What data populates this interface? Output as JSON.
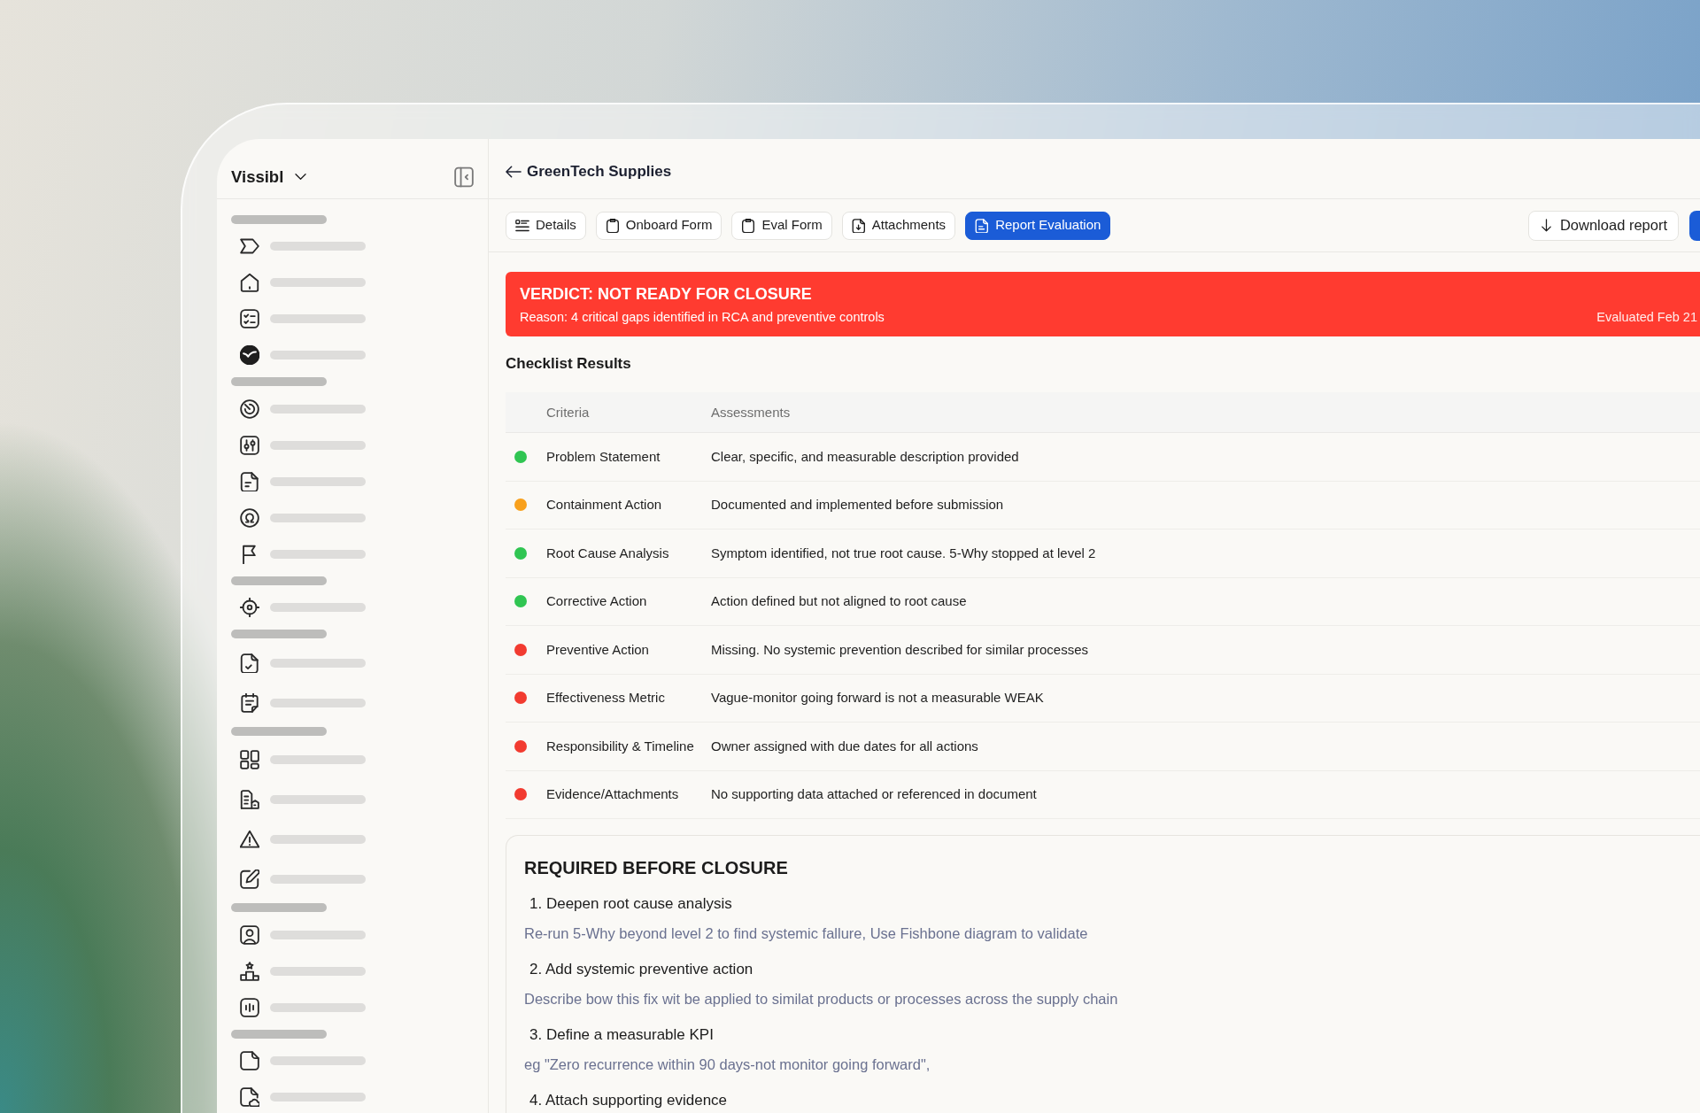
{
  "sidebar": {
    "workspace": "Vissibl"
  },
  "header": {
    "title": "GreenTech Supplies"
  },
  "tabs": [
    {
      "label": "Details",
      "selected": false
    },
    {
      "label": "Onboard Form",
      "selected": false
    },
    {
      "label": "Eval Form",
      "selected": false
    },
    {
      "label": "Attachments",
      "selected": false
    },
    {
      "label": "Report Evaluation",
      "selected": true
    }
  ],
  "actions": [
    {
      "kind": "outline",
      "label": "Download report"
    },
    {
      "kind": "primary"
    }
  ],
  "verdict": {
    "title": "VERDICT: NOT READY FOR CLOSURE",
    "reason": "Reason: 4 critical gaps identified in RCA and preventive controls",
    "evaluated": "Evaluated Feb 21"
  },
  "checklist": {
    "title": "Checklist Results",
    "columns": [
      "Criteria",
      "Assessments"
    ],
    "rows": [
      {
        "color": "#30c552",
        "criteria": "Problem Statement",
        "assessment": "Clear, specific, and measurable description provided"
      },
      {
        "color": "#f8a01c",
        "criteria": "Containment Action",
        "assessment": "Documented and implemented before submission"
      },
      {
        "color": "#30c552",
        "criteria": "Root Cause Analysis",
        "assessment": "Symptom identified, not true root cause. 5-Why stopped at level 2"
      },
      {
        "color": "#30c552",
        "criteria": "Corrective Action",
        "assessment": "Action defined but not aligned to root cause"
      },
      {
        "color": "#f23b30",
        "criteria": "Preventive Action",
        "assessment": "Missing. No systemic prevention described for similar processes"
      },
      {
        "color": "#f23b30",
        "criteria": "Effectiveness Metric",
        "assessment": "Vague-monitor going forward is not a measurable WEAK"
      },
      {
        "color": "#f23b30",
        "criteria": "Responsibility & Timeline",
        "assessment": "Owner assigned with due dates for all actions"
      },
      {
        "color": "#f23b30",
        "criteria": "Evidence/Attachments",
        "assessment": "No supporting data attached or referenced in document"
      }
    ]
  },
  "required": {
    "title": "REQUIRED BEFORE CLOSURE",
    "items": [
      {
        "title": "1. Deepen root cause analysis",
        "detail": "Re-run 5-Why beyond level 2 to find systemic fallure, Use Fishbone diagram to validate"
      },
      {
        "title": "2. Add systemic preventive action",
        "detail": "Describe bow this fix wit be applied to similat products or processes across the supply chain"
      },
      {
        "title": "3. Define a measurable KPI",
        "detail": "eg \"Zero recurrence within 90 days-not monitor going forward\","
      },
      {
        "title": "4. Attach supporting evidence"
      }
    ]
  }
}
